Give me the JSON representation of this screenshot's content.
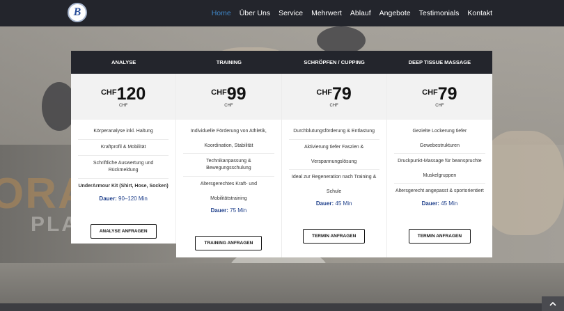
{
  "nav": {
    "logo_text": "B",
    "items": [
      "Home",
      "Über Uns",
      "Service",
      "Mehrwert",
      "Ablauf",
      "Angebote",
      "Testimonials",
      "Kontakt"
    ]
  },
  "background": {
    "text_large": "ORA",
    "text_small": "PLAY"
  },
  "plans": [
    {
      "title": "ANALYSE",
      "currency": "CHF",
      "amount": "120",
      "per": "CHF",
      "features": [
        "Körperanalyse inkl. Haltung",
        "Kraftprofil & Mobilität",
        "Schriftliche Auswertung und Rückmeldung",
        "UnderArmour Kit (Shirt, Hose, Socken)"
      ],
      "duration_label": "Dauer:",
      "duration_value": "90–120 Min",
      "button": "ANALYSE ANFRAGEN"
    },
    {
      "title": "TRAINING",
      "currency": "CHF",
      "amount": "99",
      "per": "CHF",
      "features": [
        "Individuelle Förderung von Athletik, Koordination, Stabilität",
        "Technikanpassung & Bewegungsschulung",
        "Altersgerechtes Kraft- und Mobilitätstraining"
      ],
      "duration_label": "Dauer:",
      "duration_value": "75 Min",
      "button": "TRAINING ANFRAGEN"
    },
    {
      "title": "SCHRÖPFEN / CUPPING",
      "currency": "CHF",
      "amount": "79",
      "per": "CHF",
      "features": [
        "Durchblutungsförderung & Entlastung",
        "Aktivierung tiefer Faszien & Verspannungslösung",
        "Ideal zur Regeneration nach Training & Schule"
      ],
      "duration_label": "Dauer:",
      "duration_value": "45 Min",
      "button": "TERMIN ANFRAGEN"
    },
    {
      "title": "DEEP TISSUE MASSAGE",
      "currency": "CHF",
      "amount": "79",
      "per": "CHF",
      "features": [
        "Gezielte Lockerung tiefer Gewebestrukturen",
        "Druckpunkt-Massage für beanspruchte Muskelgruppen",
        "Altersgerecht angepasst & sportorientiert"
      ],
      "duration_label": "Dauer:",
      "duration_value": "45 Min",
      "button": "TERMIN ANFRAGEN"
    }
  ],
  "colors": {
    "nav_bg": "#23252c",
    "active_link": "#3f87c9",
    "duration": "#1d3e8a"
  }
}
